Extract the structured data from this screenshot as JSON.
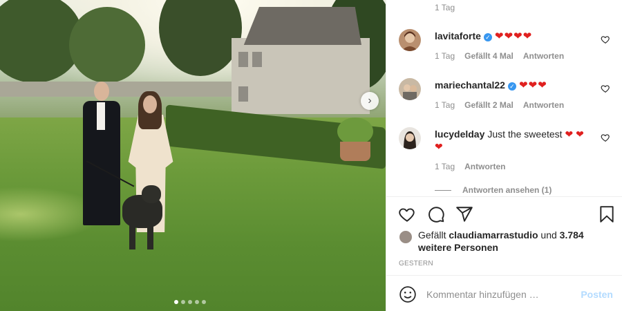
{
  "photo": {
    "carousel": {
      "total": 5,
      "active_index": 0
    },
    "next_glyph": "›"
  },
  "comments": {
    "top_meta": {
      "time": "1 Tag"
    },
    "items": [
      {
        "username": "lavitaforte",
        "verified": true,
        "text": "❤️❤️❤️❤️",
        "time": "1 Tag",
        "likes": "Gefällt 4 Mal",
        "reply": "Antworten"
      },
      {
        "username": "mariechantal22",
        "verified": true,
        "text": "❤️❤️❤️",
        "time": "1 Tag",
        "likes": "Gefällt 2 Mal",
        "reply": "Antworten"
      },
      {
        "username": "lucydelday",
        "verified": false,
        "text": "Just the sweetest ❤️ ❤️❤️",
        "time": "1 Tag",
        "likes": "",
        "reply": "Antworten"
      }
    ],
    "view_replies": "Antworten ansehen (1)"
  },
  "likes": {
    "prefix": "Gefällt",
    "user": "claudiamarrastudio",
    "middle": "und",
    "count": "3.784 weitere Personen"
  },
  "timestamp": "GESTERN",
  "add_comment": {
    "placeholder": "Kommentar hinzufügen …",
    "post_label": "Posten"
  },
  "colors": {
    "heart": "#e0201f",
    "verified": "#3897f0",
    "post_disabled": "#b3dbff",
    "muted_text": "#8e8e8e"
  }
}
